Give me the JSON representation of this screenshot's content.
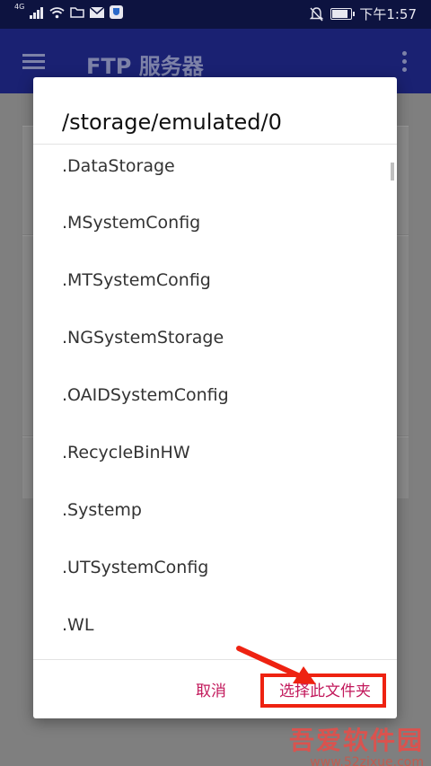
{
  "status_bar": {
    "network": "4G",
    "time": "下午1:57"
  },
  "toolbar": {
    "title": "FTP 服务器"
  },
  "dialog": {
    "title": "/storage/emulated/0",
    "folders": [
      ".DataStorage",
      ".MSystemConfig",
      ".MTSystemConfig",
      ".NGSystemStorage",
      ".OAIDSystemConfig",
      ".RecycleBinHW",
      ".Systemp",
      ".UTSystemConfig",
      ".WL"
    ],
    "cancel_label": "取消",
    "select_label": "选择此文件夹"
  },
  "watermark": {
    "logo": "吾爱软件园",
    "url": "www.52zixue.com"
  },
  "colors": {
    "status_bar_bg": "#0d1340",
    "toolbar_bg": "#1a2172",
    "accent": "#c2185b",
    "annotation": "#ee2211"
  }
}
